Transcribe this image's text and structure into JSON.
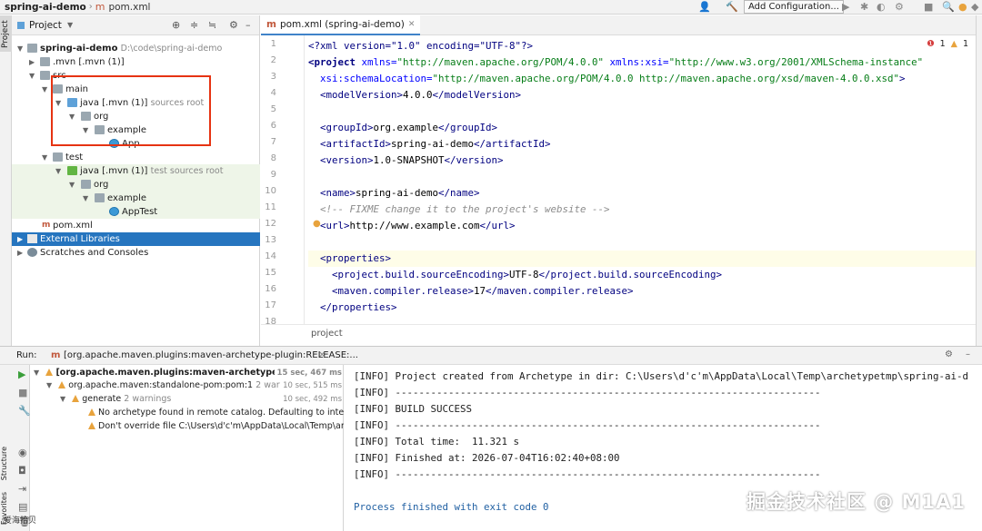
{
  "topbar": {
    "project": "spring-ai-demo",
    "file": "pom.xml",
    "add_config": "Add Configuration..."
  },
  "left_strip": {
    "project_tab": "Project",
    "structure": "Structure",
    "favorites": "Favorites"
  },
  "project_panel": {
    "title": "Project",
    "items": [
      {
        "label": "spring-ai-demo",
        "extra": "D:\\code\\spring-ai-demo"
      },
      {
        "label": ".mvn [.mvn (1)]"
      },
      {
        "label": "src"
      },
      {
        "label": "main"
      },
      {
        "label": "java [.mvn (1)]",
        "extra": "sources root"
      },
      {
        "label": "org"
      },
      {
        "label": "example"
      },
      {
        "label": "App"
      },
      {
        "label": "test"
      },
      {
        "label": "java [.mvn (1)]",
        "extra": "test sources root"
      },
      {
        "label": "org"
      },
      {
        "label": "example"
      },
      {
        "label": "AppTest"
      },
      {
        "label": "pom.xml"
      },
      {
        "label": "External Libraries"
      },
      {
        "label": "Scratches and Consoles"
      }
    ]
  },
  "editor": {
    "tab_label": "pom.xml (spring-ai-demo)",
    "inspections": {
      "errors": "1",
      "warnings": "1"
    },
    "line_numbers": [
      "1",
      "2",
      "3",
      "4",
      "5",
      "6",
      "7",
      "8",
      "9",
      "10",
      "11",
      "12",
      "13",
      "14",
      "15",
      "16",
      "17",
      "18"
    ],
    "breadcrumb": "project",
    "code": {
      "l1a": "<?xml version=\"1.0\" encoding=\"UTF-8\"?>",
      "l2_tag": "<project ",
      "l2_attr1": "xmlns=",
      "l2_val1": "\"http://maven.apache.org/POM/4.0.0\"",
      "l2_attr2": " xmlns:xsi=",
      "l2_val2": "\"http://www.w3.org/2001/XMLSchema-instance\"",
      "l3_attr": "  xsi:schemaLocation=",
      "l3_val": "\"http://maven.apache.org/POM/4.0.0 http://maven.apache.org/xsd/maven-4.0.0.xsd\"",
      "l3_end": ">",
      "l4_open": "  <modelVersion>",
      "l4_txt": "4.0.0",
      "l4_close": "</modelVersion>",
      "l6_open": "  <groupId>",
      "l6_txt": "org.example",
      "l6_close": "</groupId>",
      "l7_open": "  <artifactId>",
      "l7_txt": "spring-ai-demo",
      "l7_close": "</artifactId>",
      "l8_open": "  <version>",
      "l8_txt": "1.0-SNAPSHOT",
      "l8_close": "</version>",
      "l10_open": "  <name>",
      "l10_txt": "spring-ai-demo",
      "l10_close": "</name>",
      "l11": "  <!-- FIXME change it to the project's website -->",
      "l12_open": "  <url>",
      "l12_txt": "http://www.example.com",
      "l12_close": "</url>",
      "l14": "  <properties>",
      "l15_open": "    <project.build.sourceEncoding>",
      "l15_txt": "UTF-8",
      "l15_close": "</project.build.sourceEncoding>",
      "l16_open": "    <maven.compiler.release>",
      "l16_txt": "17",
      "l16_close": "</maven.compiler.release>",
      "l17": "  </properties>"
    }
  },
  "run": {
    "label": "Run:",
    "tab": "[org.apache.maven.plugins:maven-archetype-plugin:RELEASE:...",
    "tree": [
      {
        "label": "[org.apache.maven.plugins:maven-archetype-plugin:RI",
        "time": "15 sec, 467 ms"
      },
      {
        "label": "org.apache.maven:standalone-pom:pom:1",
        "extra": "2 warnings",
        "time": "10 sec, 515 ms"
      },
      {
        "label": "generate",
        "extra": "2 warnings",
        "time": "10 sec, 492 ms"
      },
      {
        "label": "No archetype found in remote catalog. Defaulting to internal c"
      },
      {
        "label": "Don't override file C:\\Users\\d'c'm\\AppData\\Local\\Temp\\archety"
      }
    ],
    "console": [
      "[INFO] Project created from Archetype in dir: C:\\Users\\d'c'm\\AppData\\Local\\Temp\\archetypetmp\\spring-ai-d",
      "[INFO] ------------------------------------------------------------------------",
      "[INFO] BUILD SUCCESS",
      "[INFO] ------------------------------------------------------------------------",
      "[INFO] Total time:  11.321 s",
      "[INFO] Finished at: 2026-07-04T16:02:40+08:00",
      "[INFO] ------------------------------------------------------------------------",
      "",
      "Process finished with exit code 0"
    ]
  },
  "watermark": "掘金技术社区 @ M1A1",
  "watermark2": "爱海拾贝"
}
